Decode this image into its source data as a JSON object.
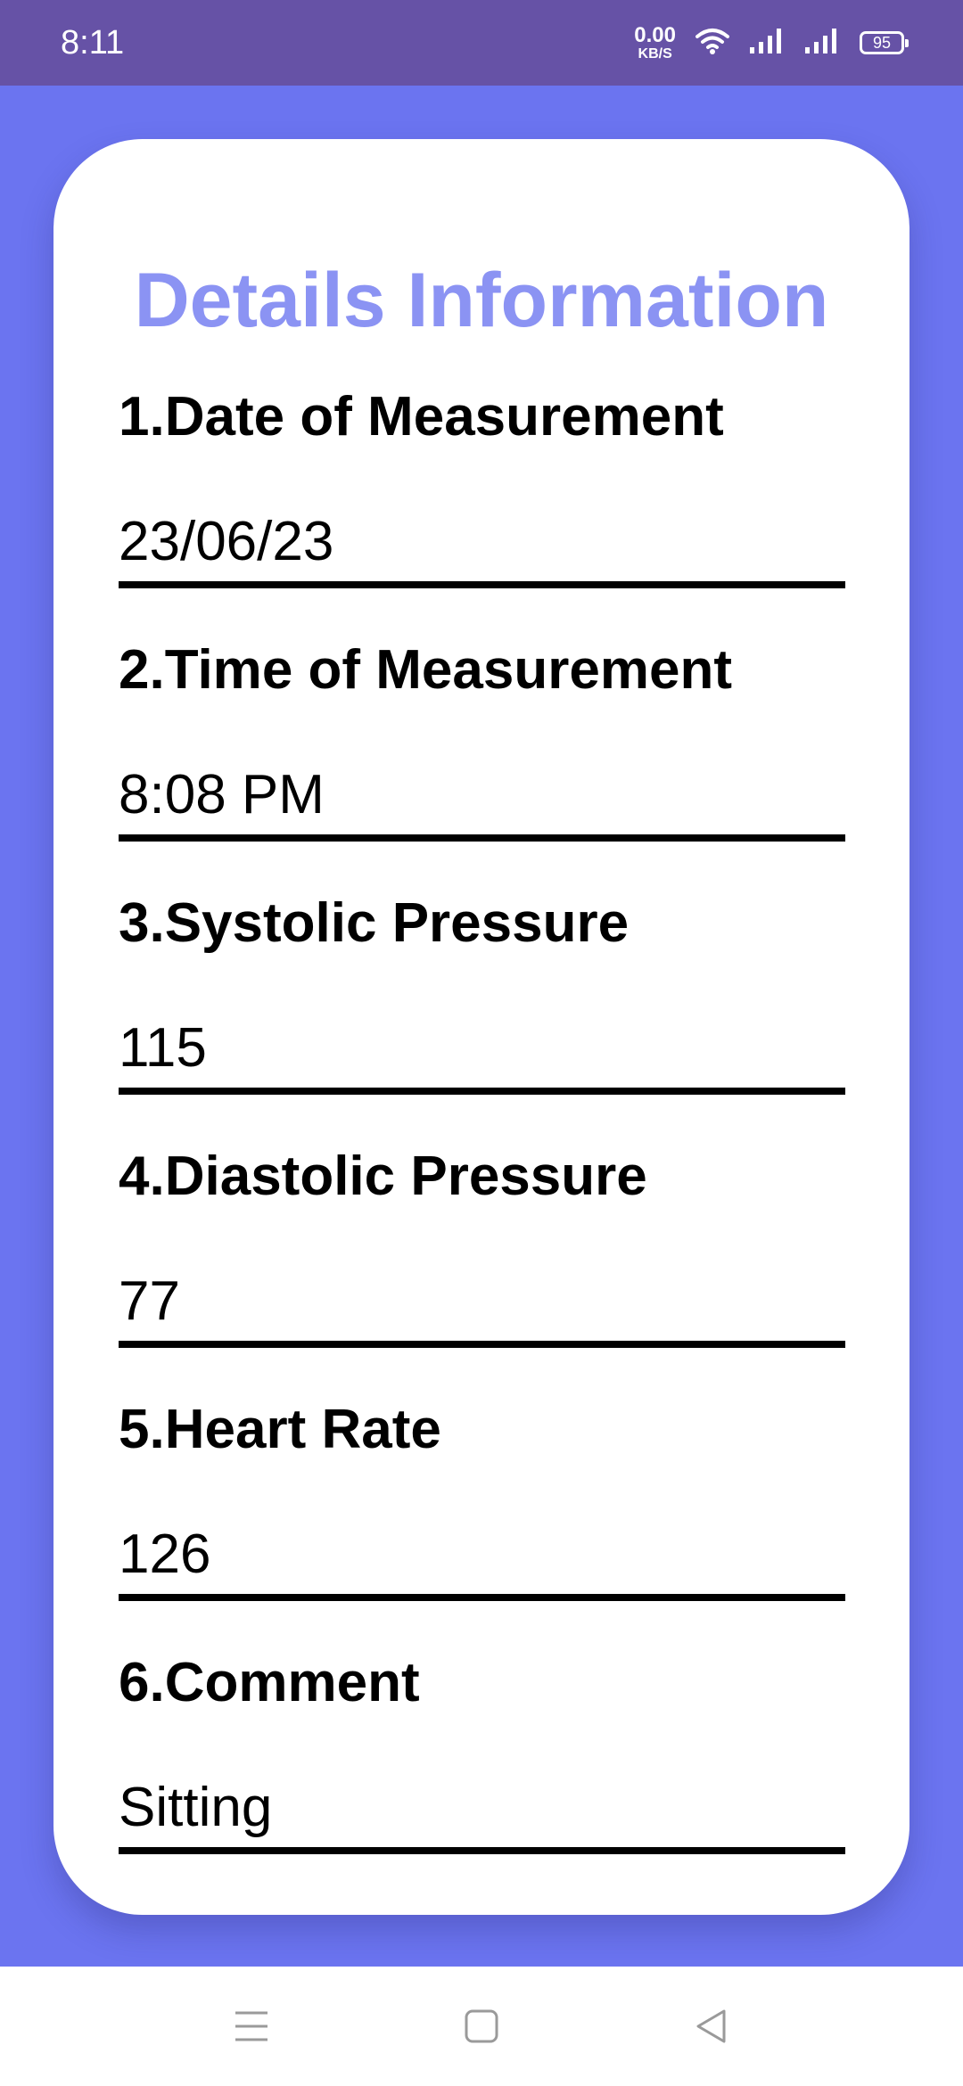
{
  "status_bar": {
    "time": "8:11",
    "net_speed_value": "0.00",
    "net_speed_unit": "KB/S",
    "battery_level": "95"
  },
  "details": {
    "title": "Details Information",
    "fields": [
      {
        "label": "1.Date of Measurement",
        "value": "23/06/23"
      },
      {
        "label": "2.Time of Measurement",
        "value": "8:08 PM"
      },
      {
        "label": "3.Systolic Pressure",
        "value": "115"
      },
      {
        "label": "4.Diastolic Pressure",
        "value": "77"
      },
      {
        "label": "5.Heart Rate",
        "value": "126"
      },
      {
        "label": "6.Comment",
        "value": "Sitting"
      }
    ]
  },
  "nav_bar": {
    "icons": [
      "menu-icon",
      "home-square-icon",
      "back-triangle-icon"
    ]
  },
  "colors": {
    "status_bar_bg": "#6652a6",
    "page_bg": "#6b74f0",
    "title_accent": "#8b93f3",
    "card_bg": "#ffffff"
  }
}
